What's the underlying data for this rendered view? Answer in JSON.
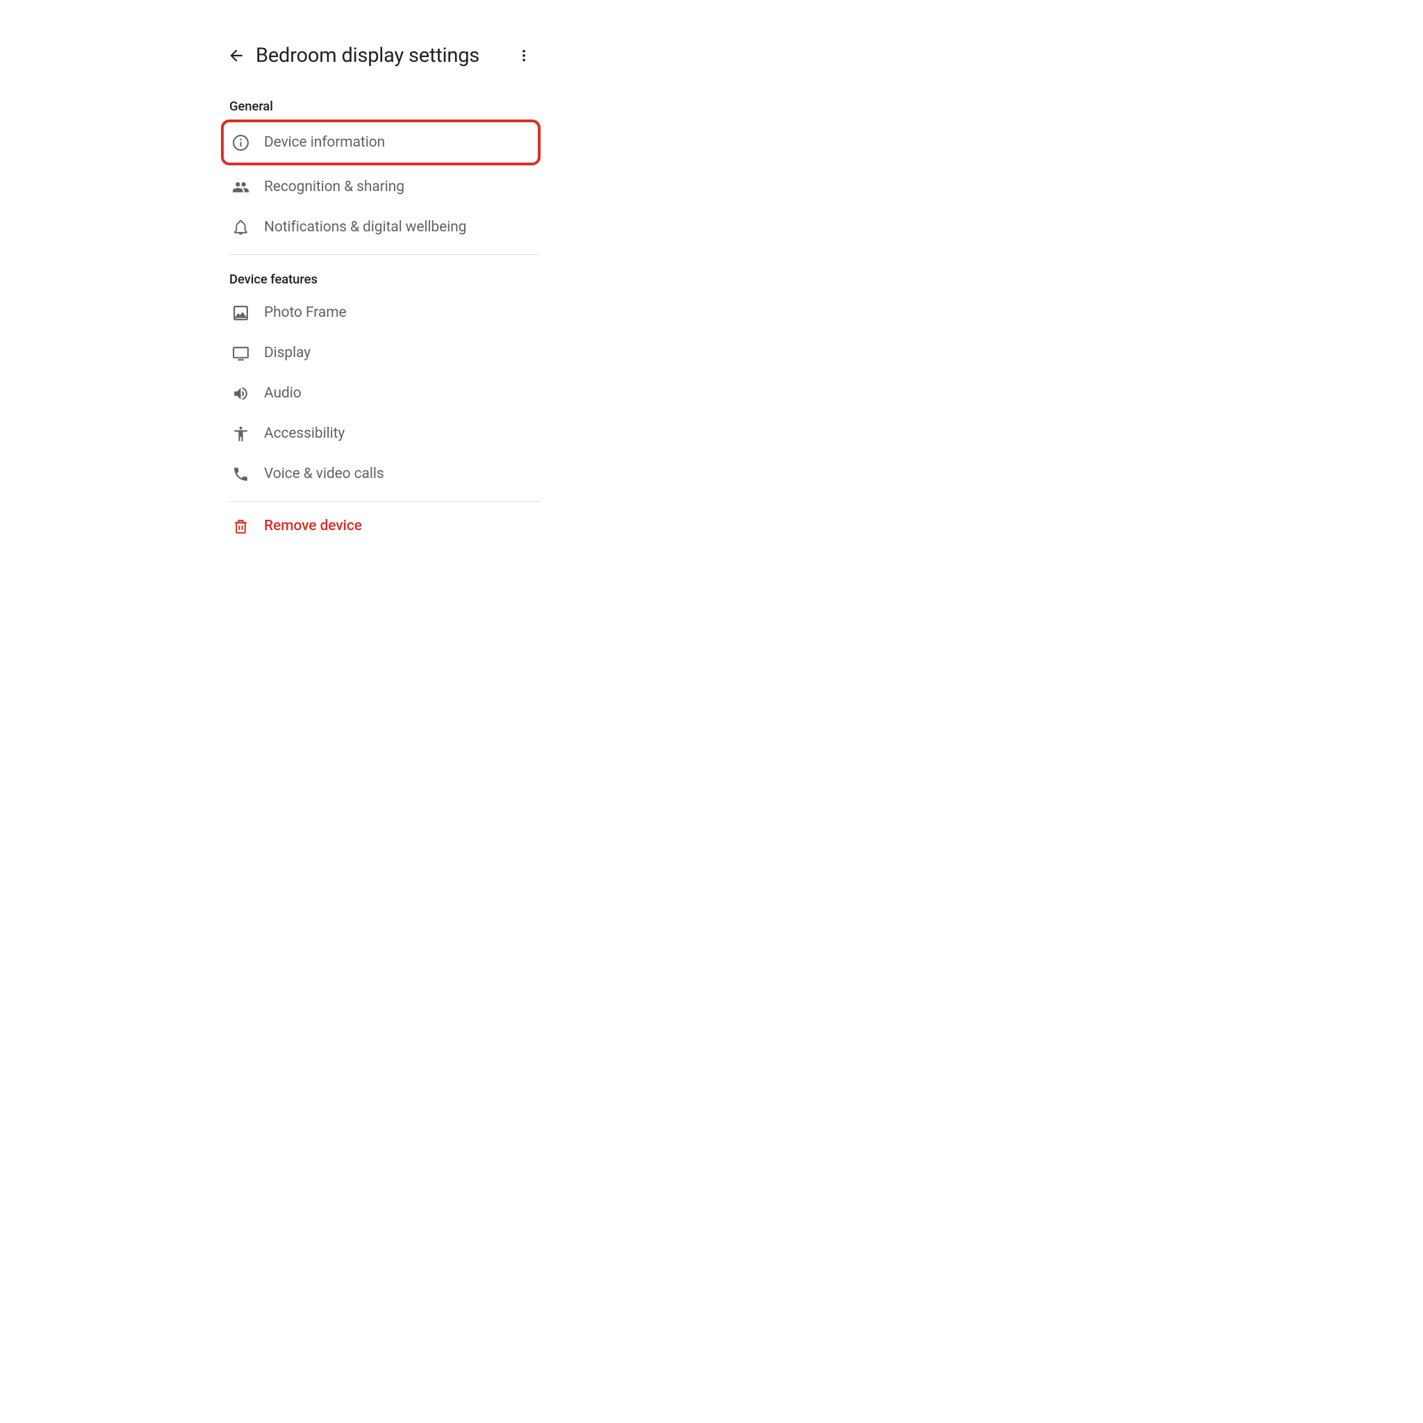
{
  "header": {
    "title": "Bedroom display settings"
  },
  "sections": {
    "general": {
      "header": "General",
      "items": {
        "device_information": "Device information",
        "recognition_sharing": "Recognition & sharing",
        "notifications": "Notifications & digital wellbeing"
      }
    },
    "device_features": {
      "header": "Device features",
      "items": {
        "photo_frame": "Photo Frame",
        "display": "Display",
        "audio": "Audio",
        "accessibility": "Accessibility",
        "voice_video_calls": "Voice & video calls"
      }
    }
  },
  "actions": {
    "remove_device": "Remove device"
  },
  "colors": {
    "highlight": "#d93025",
    "text_primary": "#202124",
    "text_secondary": "#5f6368"
  }
}
